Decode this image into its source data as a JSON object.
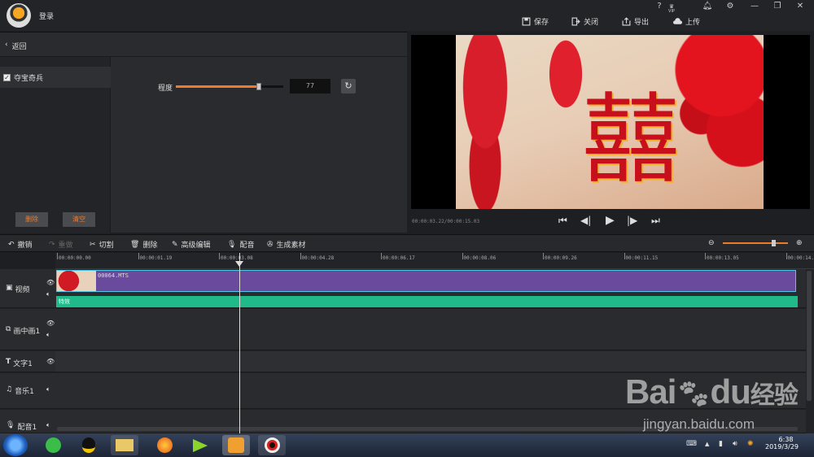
{
  "titlebar": {
    "login": "登录",
    "save": "保存",
    "close": "关闭",
    "export": "导出",
    "upload": "上传",
    "help": "?",
    "vip": "VIP"
  },
  "leftpanel": {
    "back": "返回",
    "effect_name": "夺宝奇兵",
    "delete": "删除",
    "clear": "清空",
    "degree_label": "程度",
    "degree_value": "77",
    "degree_level": 0.77
  },
  "preview": {
    "time": "00:00:03.22/00:00:15.03"
  },
  "toolbar": {
    "undo": "撤销",
    "redo": "重做",
    "cut": "切割",
    "delete": "删除",
    "advanced": "高级编辑",
    "dub": "配音",
    "generate": "生成素材"
  },
  "ruler": {
    "ticks": [
      "00:00:00.00",
      "00:00:01.19",
      "00:00:03.08",
      "00:00:04.28",
      "00:00:06.17",
      "00:00:08.06",
      "00:00:09.26",
      "00:00:11.15",
      "00:00:13.05",
      "00:00:14.2"
    ]
  },
  "tracks": {
    "video": "视频",
    "pip": "画中画1",
    "text": "文字1",
    "music": "音乐1",
    "voice": "配音1",
    "clip_name": "00064.MTS",
    "effect_bar": "特效"
  },
  "taskbar": {
    "time": "6:38",
    "date": "2019/3/29"
  },
  "watermark": {
    "site": "jingyan.baidu.com",
    "brand": "Bai",
    "brand2": "du",
    "jy": "经验"
  },
  "colors": {
    "accent": "#f07a2a",
    "clip": "#6a4a9c",
    "effect": "#1fb98a",
    "playhead": "#dddddd"
  }
}
